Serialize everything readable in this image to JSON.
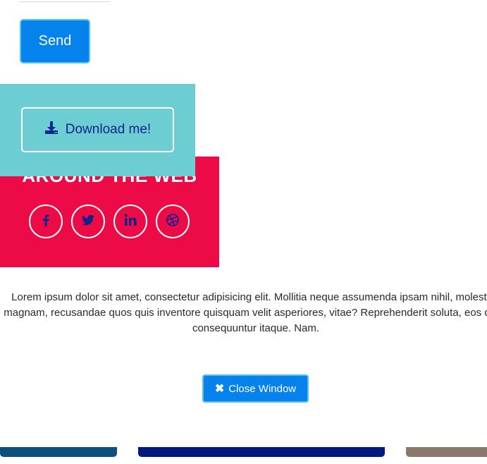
{
  "form": {
    "send_label": "Send"
  },
  "download": {
    "label": "Download me!",
    "icon": "download-icon"
  },
  "social": {
    "title": "AROUND THE WEB",
    "icons": [
      "facebook-icon",
      "twitter-icon",
      "linkedin-icon",
      "dribbble-icon"
    ]
  },
  "modal": {
    "body_text": "Lorem ipsum dolor sit amet, consectetur adipisicing elit. Mollitia neque assumenda ipsam nihil, molestias magnam, recusandae quos quis inventore quisquam velit asperiores, vitae? Reprehenderit soluta, eos quod consequuntur itaque. Nam.",
    "close_label": "Close Window",
    "close_icon": "close-icon"
  },
  "colors": {
    "primary_blue": "#0582ec",
    "teal": "#6ccdd2",
    "crimson": "#ec0a47",
    "navy_text": "#0d2591"
  }
}
